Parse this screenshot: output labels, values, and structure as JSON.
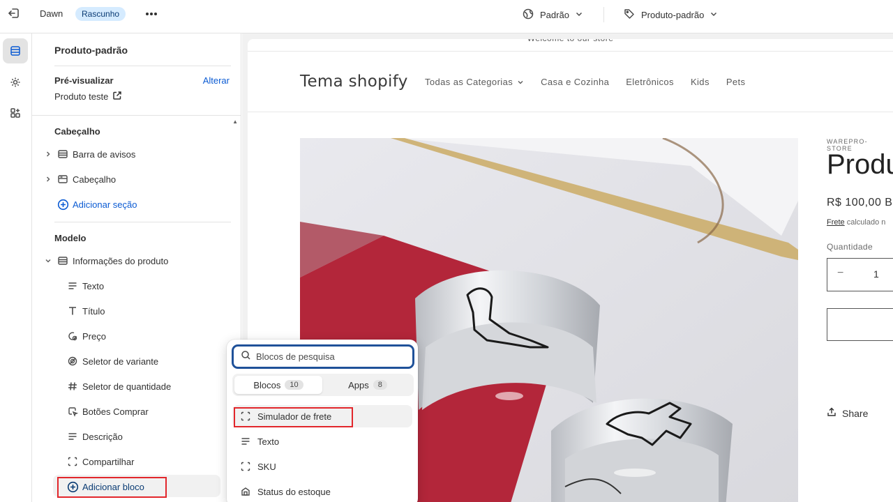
{
  "topbar": {
    "theme_name": "Dawn",
    "status_badge": "Rascunho",
    "locale_selector": "Padrão",
    "template_selector": "Produto-padrão"
  },
  "panel": {
    "title": "Produto-padrão",
    "preview_label": "Pré-visualizar",
    "preview_change": "Alterar",
    "preview_product": "Produto teste",
    "header_group": {
      "title": "Cabeçalho",
      "items": [
        {
          "label": "Barra de avisos"
        },
        {
          "label": "Cabeçalho"
        }
      ],
      "add_section": "Adicionar seção"
    },
    "template_group": {
      "title": "Modelo",
      "section": "Informações do produto",
      "blocks": [
        {
          "label": "Texto",
          "icon": "text-icon"
        },
        {
          "label": "Título",
          "icon": "title-icon"
        },
        {
          "label": "Preço",
          "icon": "price-tag-icon"
        },
        {
          "label": "Seletor de variante",
          "icon": "variant-icon"
        },
        {
          "label": "Seletor de quantidade",
          "icon": "hashtag-icon"
        },
        {
          "label": "Botões Comprar",
          "icon": "buy-button-icon"
        },
        {
          "label": "Descrição",
          "icon": "text-icon"
        },
        {
          "label": "Compartilhar",
          "icon": "dashed-square-icon"
        }
      ],
      "add_block": "Adicionar bloco"
    }
  },
  "preview": {
    "announcement": "Welcome to our store",
    "store_name": "Tema shopify",
    "nav": [
      "Todas as Categorias",
      "Casa e Cozinha",
      "Eletrônicos",
      "Kids",
      "Pets"
    ],
    "vendor": "WAREPRO-STORE",
    "product_title": "Produ",
    "price": "R$ 100,00 B",
    "shipping_link": "Frete",
    "shipping_text": "calculado n",
    "quantity_label": "Quantidade",
    "quantity_minus": "−",
    "quantity_value": "1",
    "share": "Share"
  },
  "popover": {
    "search_placeholder": "Blocos de pesquisa",
    "tabs": [
      {
        "label": "Blocos",
        "count": "10"
      },
      {
        "label": "Apps",
        "count": "8"
      }
    ],
    "items": [
      {
        "label": "Simulador de frete",
        "icon": "dashed-square-icon"
      },
      {
        "label": "Texto",
        "icon": "text-icon"
      },
      {
        "label": "SKU",
        "icon": "dashed-square-icon"
      },
      {
        "label": "Status do estoque",
        "icon": "inventory-icon"
      }
    ]
  },
  "colors": {
    "accent": "#0b5bd3",
    "highlight": "#e2262b",
    "badge_bg": "#d5ebff"
  }
}
